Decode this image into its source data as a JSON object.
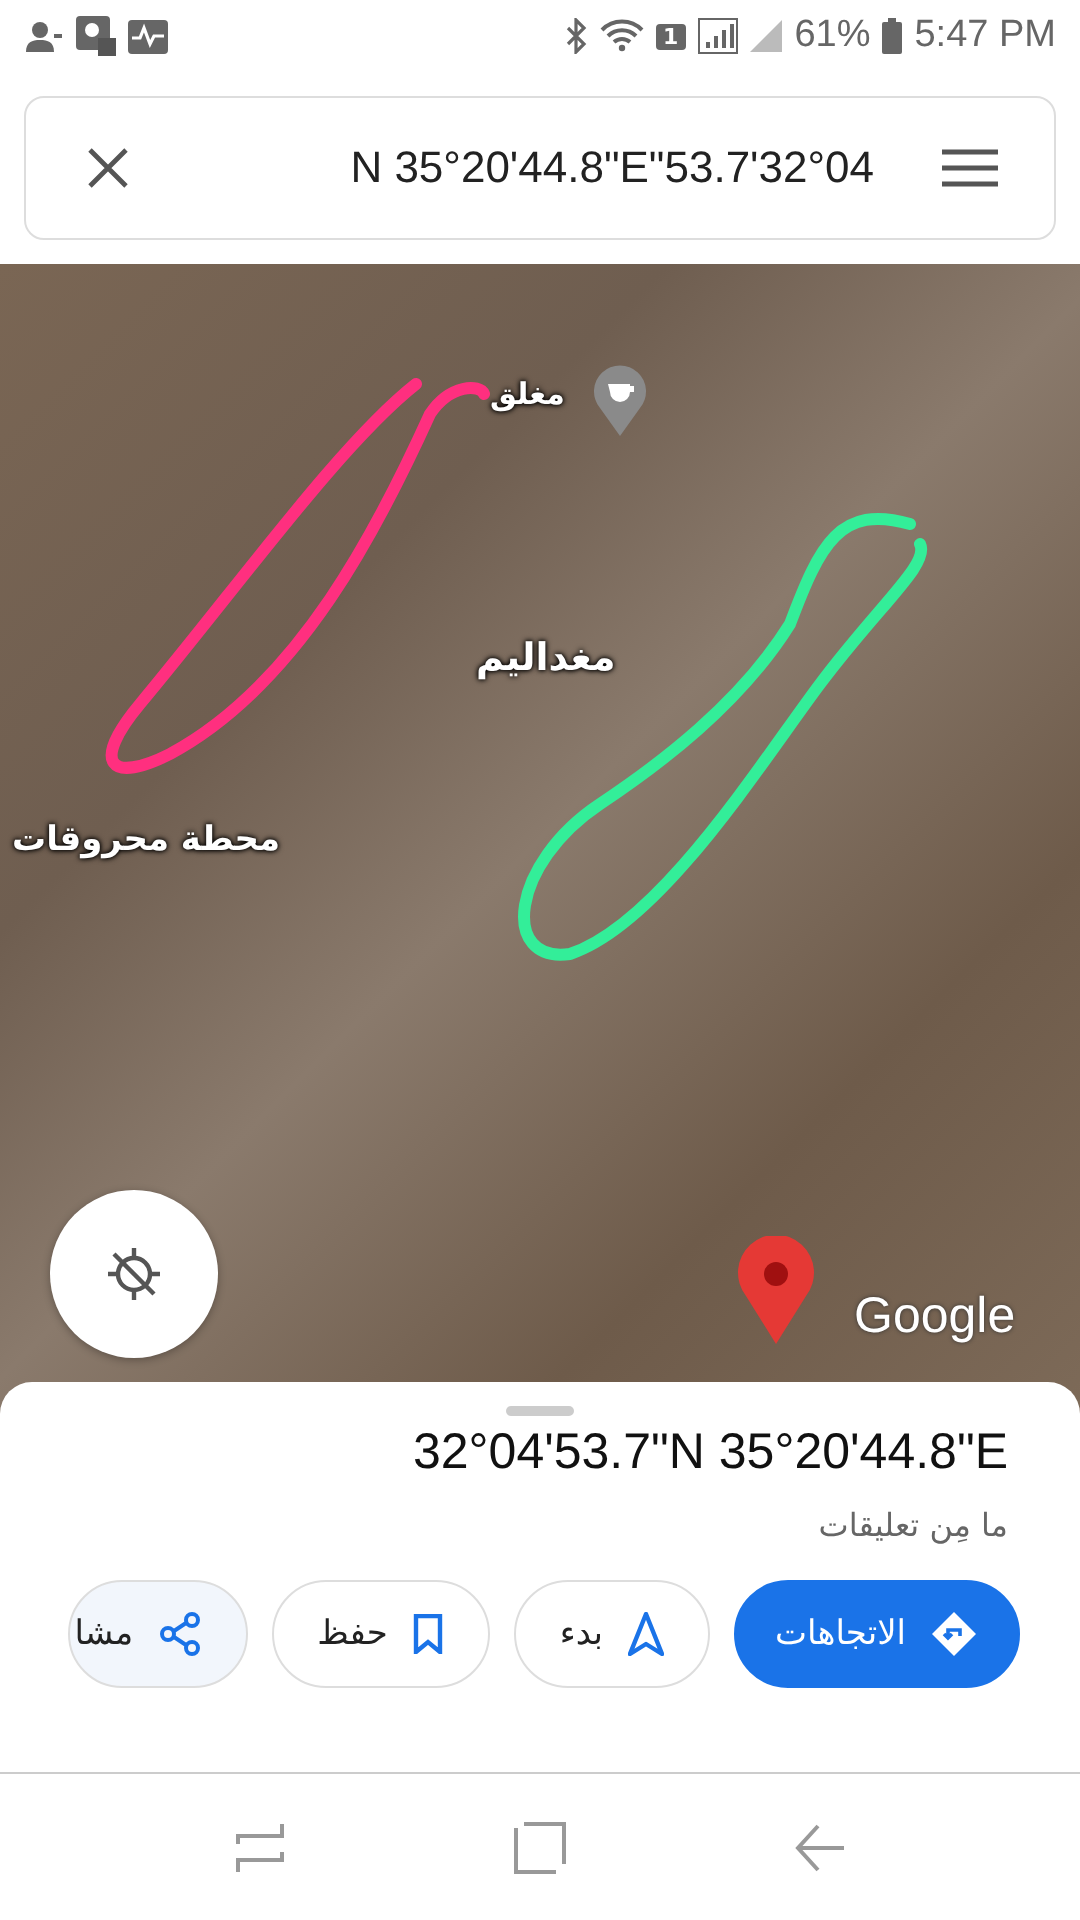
{
  "status_bar": {
    "sim_badge": "1",
    "battery": "61%",
    "time": "5:47 PM"
  },
  "search": {
    "value": "N 35°20'44.8\"E\"53.7'32°04"
  },
  "map": {
    "labels": [
      {
        "text": "مغلق",
        "kind": "poi"
      },
      {
        "text": "مغداليم",
        "kind": "area"
      },
      {
        "text": "محطة محروقات",
        "kind": "station"
      }
    ],
    "logo": "Google"
  },
  "place": {
    "title": "32°04'53.7\"N 35°20'44.8\"E",
    "subtitle": "ما مِن تعليقات"
  },
  "actions": [
    {
      "label": "الاتجاهات",
      "kind": "directions",
      "primary": true
    },
    {
      "label": "بدء",
      "kind": "start",
      "primary": false
    },
    {
      "label": "حفظ",
      "kind": "save",
      "primary": false
    },
    {
      "label": "مشا",
      "kind": "share",
      "primary": false
    }
  ]
}
